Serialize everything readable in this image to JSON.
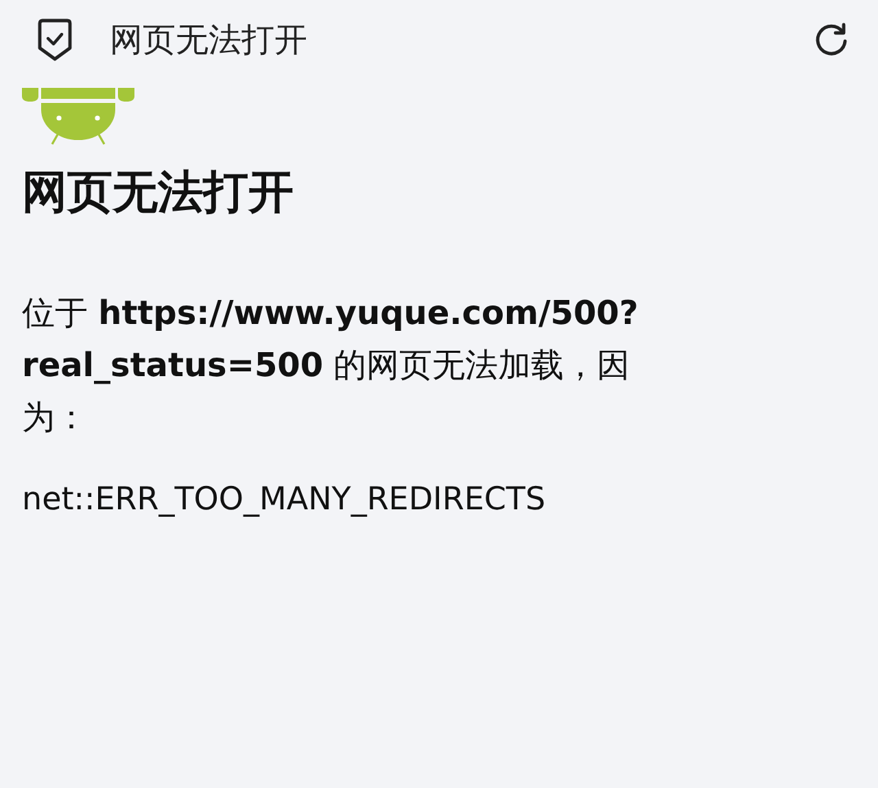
{
  "top_bar": {
    "title": "网页无法打开"
  },
  "heading": "网页无法打开",
  "message": "位于 **https://www.yuque.com/500?real_status=500** 的网页无法加载，因为：",
  "error_code": "net::ERR_TOO_MANY_REDIRECTS"
}
